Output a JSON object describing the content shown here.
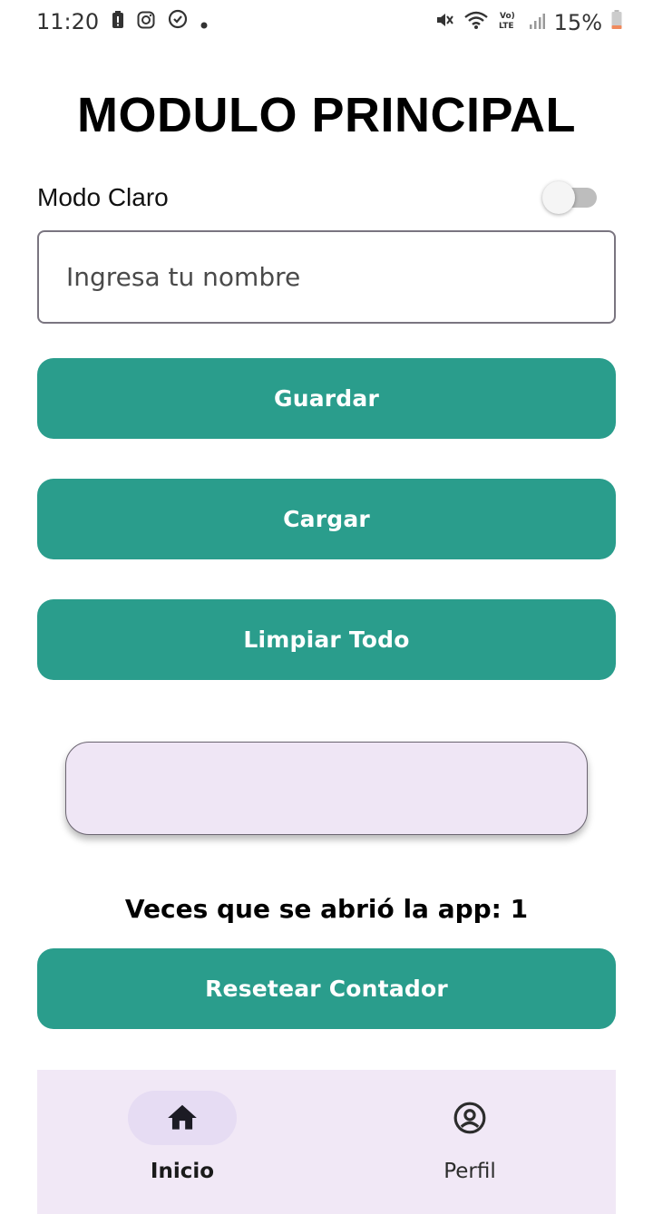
{
  "status_bar": {
    "time": "11:20",
    "battery_percent": "15%",
    "left_icons": [
      "battery-alert-icon",
      "instagram-icon",
      "app-notification-icon",
      "dot-icon"
    ],
    "right_icons": [
      "mute-icon",
      "wifi-icon",
      "volte-icon",
      "signal-icon",
      "battery-icon"
    ],
    "volte_label": "Vo)\nLTE"
  },
  "page": {
    "title": "MODULO PRINCIPAL",
    "mode_label": "Modo Claro",
    "mode_toggle_on": false
  },
  "name_field": {
    "placeholder": "Ingresa tu nombre",
    "value": ""
  },
  "buttons": {
    "save": "Guardar",
    "load": "Cargar",
    "clear_all": "Limpiar Todo",
    "reset_counter": "Resetear Contador"
  },
  "output": {
    "text": ""
  },
  "counter": {
    "text": "Veces que se abrió la app: 1"
  },
  "bottom_nav": {
    "items": [
      {
        "label": "Inicio",
        "icon": "home-icon",
        "active": true
      },
      {
        "label": "Perfil",
        "icon": "account-circle-icon",
        "active": false
      }
    ]
  },
  "colors": {
    "primary": "#2a9d8c",
    "nav_background": "#f1e8f6",
    "card_background": "#efe6f5",
    "active_pill": "#e6dcf3"
  }
}
